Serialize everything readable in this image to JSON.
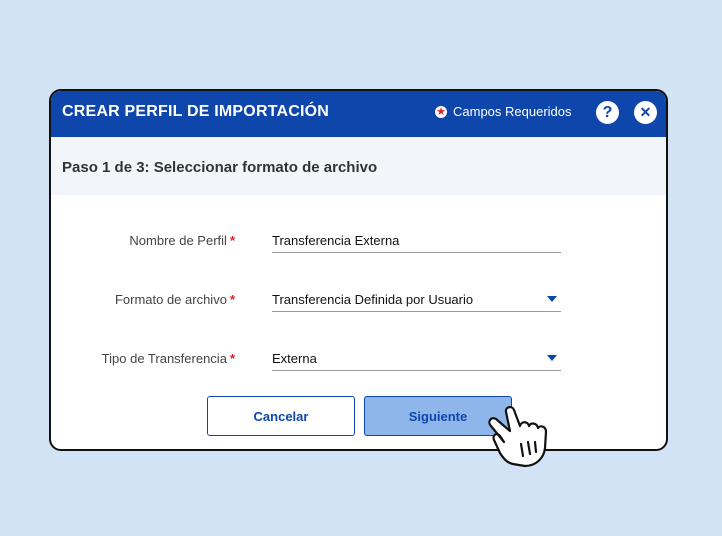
{
  "dialog": {
    "title": "CREAR PERFIL DE IMPORTACIÓN",
    "required_label": "Campos Requeridos",
    "help_glyph": "?",
    "close_glyph": "✕",
    "step_label": "Paso 1 de 3:  Seleccionar formato de archivo"
  },
  "form": {
    "fields": [
      {
        "label": "Nombre de Perfil",
        "value": "Transferencia Externa",
        "type": "text"
      },
      {
        "label": "Formato de archivo",
        "value": "Transferencia Definida por Usuario",
        "type": "select"
      },
      {
        "label": "Tipo de Transferencia",
        "value": "Externa",
        "type": "select"
      }
    ],
    "required_mark": "*"
  },
  "buttons": {
    "cancel": "Cancelar",
    "next": "Siguiente"
  },
  "colors": {
    "brand": "#0e46ac",
    "required": "#e02020",
    "background": "#d3e3f6"
  },
  "icons": [
    "required-star-icon",
    "help-icon",
    "close-icon",
    "dropdown-caret-icon",
    "hand-pointer-icon"
  ]
}
